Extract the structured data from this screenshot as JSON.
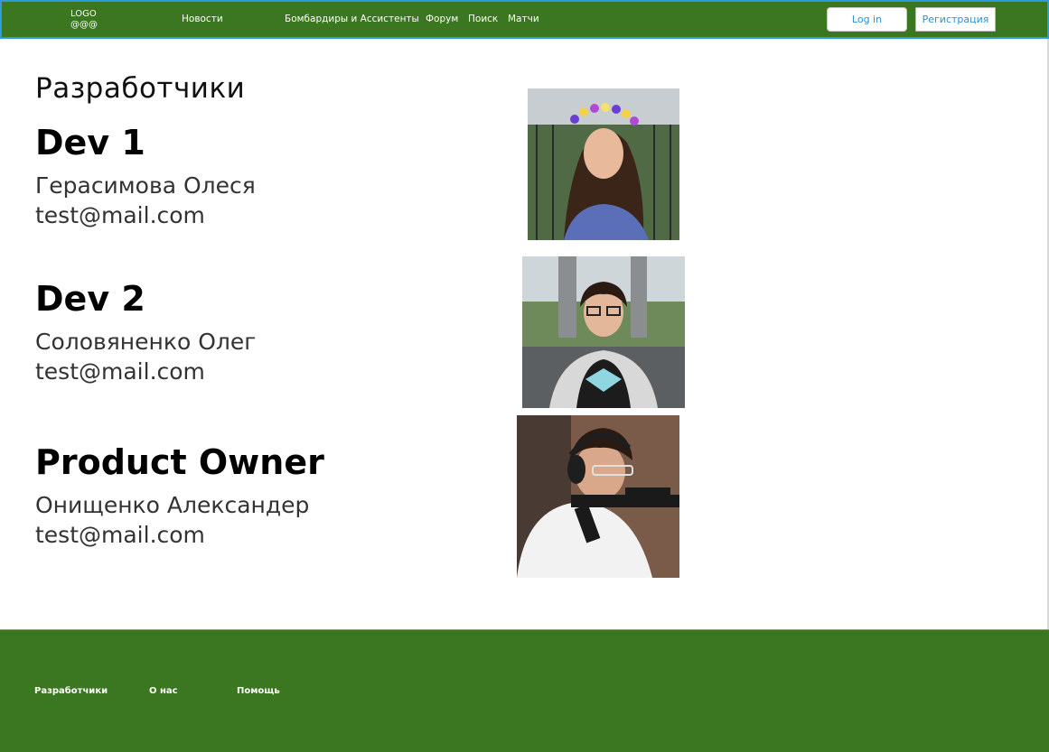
{
  "header": {
    "logo_line1": "LOGO",
    "logo_line2": "@@@",
    "nav": {
      "news": "Новости",
      "scorers": "Бомбардиры и Ассистенты",
      "forum": "Форум",
      "search": "Поиск",
      "matches": "Матчи"
    },
    "login_label": "Log in",
    "register_label": "Регистрация"
  },
  "main": {
    "title": "Разработчики",
    "developers": [
      {
        "role": "Dev 1",
        "name": "Герасимова Олеся",
        "email": "test@mail.com"
      },
      {
        "role": "Dev 2",
        "name": "Соловяненко Олег",
        "email": "test@mail.com"
      },
      {
        "role": "Product Owner",
        "name": "Онищенко Александер",
        "email": "test@mail.com"
      }
    ]
  },
  "footer": {
    "links": [
      "Разработчики",
      "О нас",
      "Помощь"
    ]
  },
  "colors": {
    "brand_green": "#3b7620",
    "header_border": "#2d9be0",
    "button_text": "#2f8fd0"
  }
}
